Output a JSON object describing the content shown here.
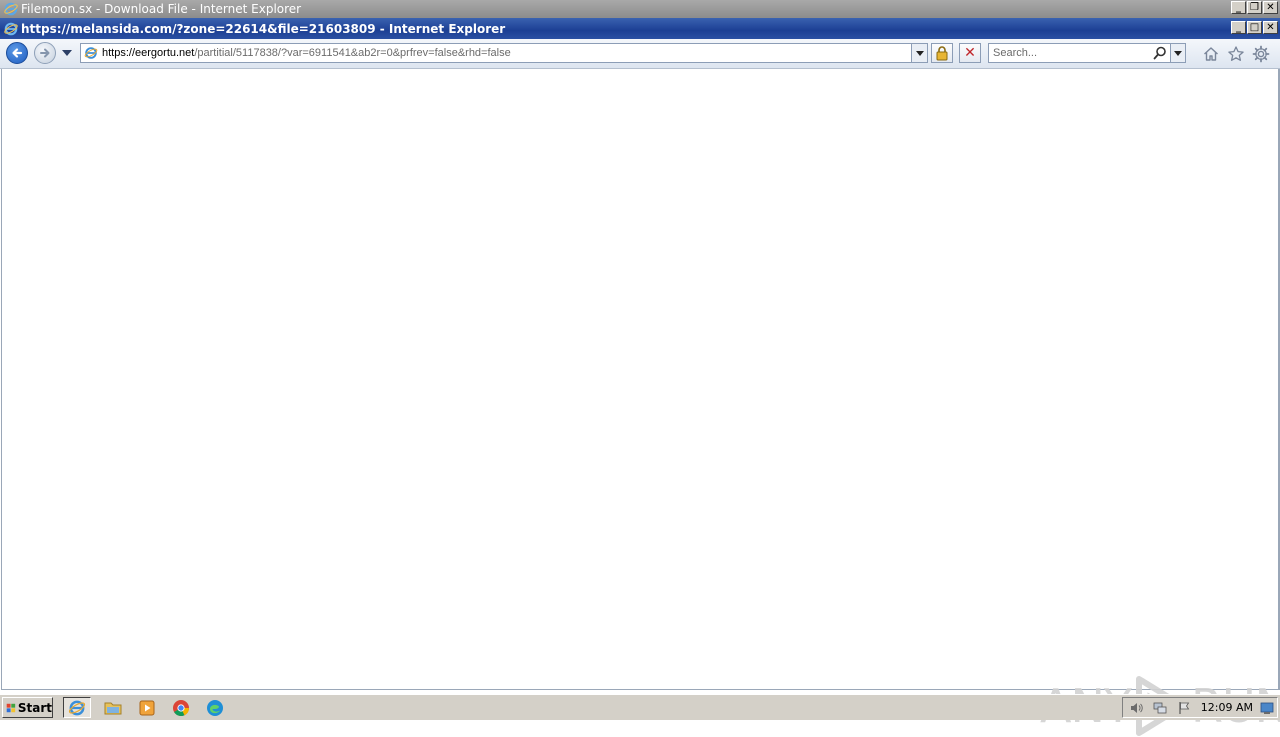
{
  "outer_window": {
    "title": "Filemoon.sx - Download File - Internet Explorer",
    "buttons": {
      "minimize": "_",
      "restore": "❐",
      "close": "✕"
    }
  },
  "inner_window": {
    "title": "https://melansida.com/?zone=22614&file=21603809 - Internet Explorer",
    "buttons": {
      "minimize": "_",
      "maximize": "□",
      "close": "✕"
    }
  },
  "address_bar": {
    "domain_part": "https://eergortu.net",
    "path_part": "/partitial/5117838/?var=6911541&ab2r=0&prfrev=false&rhd=false"
  },
  "search": {
    "placeholder": "Search..."
  },
  "stop_label": "✕",
  "watermark": {
    "left": "ANY",
    "right": "RUN"
  },
  "taskbar": {
    "start_label": "Start",
    "clock": "12:09 AM"
  },
  "colors": {
    "title_active": "#1c3f94",
    "title_inactive": "#8c8c8c",
    "taskbar": "#d4d0c8"
  }
}
